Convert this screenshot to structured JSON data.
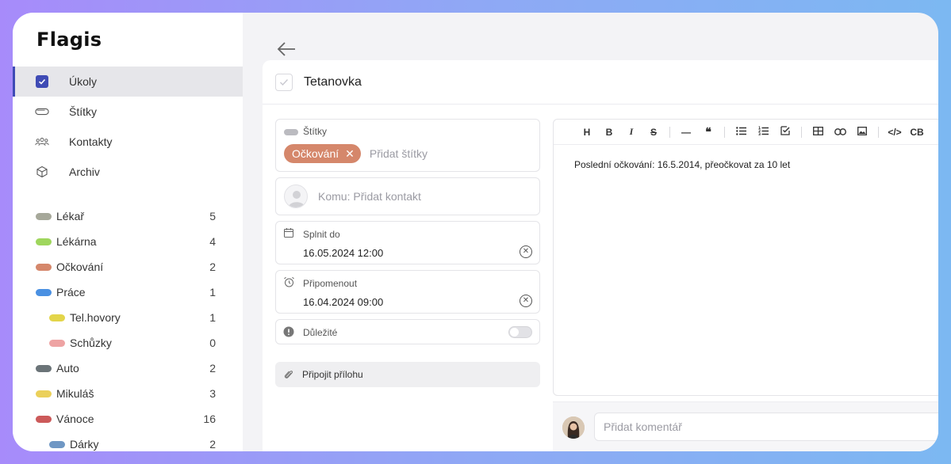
{
  "app": {
    "logo": "Flagis"
  },
  "nav": [
    {
      "label": "Úkoly",
      "icon": "checkbox-icon",
      "active": true
    },
    {
      "label": "Štítky",
      "icon": "tag-icon"
    },
    {
      "label": "Kontakty",
      "icon": "contacts-icon"
    },
    {
      "label": "Archiv",
      "icon": "archive-icon"
    }
  ],
  "tags": [
    {
      "name": "Lékař",
      "count": "5",
      "color": "#a6a89a",
      "level": 0
    },
    {
      "name": "Lékárna",
      "count": "4",
      "color": "#9fd65d",
      "level": 0
    },
    {
      "name": "Očkování",
      "count": "2",
      "color": "#d5876b",
      "level": 0
    },
    {
      "name": "Práce",
      "count": "1",
      "color": "#4a90e2",
      "level": 0
    },
    {
      "name": "Tel.hovory",
      "count": "1",
      "color": "#e3d54a",
      "level": 1
    },
    {
      "name": "Schůzky",
      "count": "0",
      "color": "#eea3a3",
      "level": 1
    },
    {
      "name": "Auto",
      "count": "2",
      "color": "#6b7478",
      "level": 0
    },
    {
      "name": "Mikuláš",
      "count": "3",
      "color": "#ebd05a",
      "level": 0
    },
    {
      "name": "Vánoce",
      "count": "16",
      "color": "#cc5a5a",
      "level": 0
    },
    {
      "name": "Dárky",
      "count": "2",
      "color": "#6f97c4",
      "level": 1
    }
  ],
  "task": {
    "title": "Tetanovka",
    "tags_label": "Štítky",
    "tag_chip": "Očkování",
    "tag_chip_color": "#d5876b",
    "tags_placeholder": "Přidat štítky",
    "contact_placeholder": "Komu: Přidat kontakt",
    "due_label": "Splnit do",
    "due_value": "16.05.2024 12:00",
    "reminder_label": "Připomenout",
    "reminder_value": "16.04.2024 09:00",
    "important_label": "Důležité",
    "attach_label": "Připojit přílohu"
  },
  "editor": {
    "toolbar": [
      "H",
      "B",
      "I",
      "S",
      "—",
      "❝",
      "list",
      "numbered-list",
      "checklist",
      "table",
      "link",
      "image",
      "</>",
      "CB"
    ],
    "content": "Poslední očkování: 16.5.2014, přeočkovat za 10 let"
  },
  "comment": {
    "placeholder": "Přidat komentář"
  }
}
